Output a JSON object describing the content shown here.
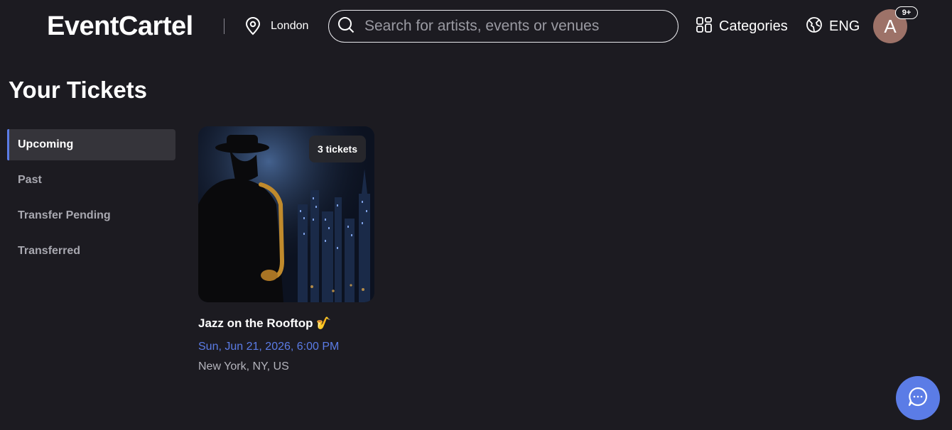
{
  "header": {
    "logo": "EventCartel",
    "location": {
      "icon": "map-pin-icon",
      "label": "London"
    },
    "search": {
      "icon": "search-icon",
      "placeholder": "Search for artists, events or venues",
      "value": ""
    },
    "categories": {
      "icon": "grid-icon",
      "label": "Categories"
    },
    "language": {
      "icon": "globe-icon",
      "label": "ENG"
    },
    "avatar": {
      "initial": "A",
      "color": "#9d7268"
    },
    "notifications": {
      "badge": "9+"
    }
  },
  "page": {
    "title": "Your Tickets"
  },
  "sidebar": {
    "items": [
      {
        "label": "Upcoming",
        "active": true
      },
      {
        "label": "Past",
        "active": false
      },
      {
        "label": "Transfer Pending",
        "active": false
      },
      {
        "label": "Transferred",
        "active": false
      }
    ]
  },
  "tickets": [
    {
      "badge": "3 tickets",
      "title": "Jazz on the Rooftop 🎷",
      "date": "Sun, Jun 21, 2026, 6:00 PM",
      "location": "New York, NY, US"
    }
  ],
  "chat": {
    "icon": "chat-bubble-icon"
  },
  "colors": {
    "background": "#1c1b21",
    "accent": "#5b7ce6",
    "sidebar_active_bg": "#35343a"
  }
}
